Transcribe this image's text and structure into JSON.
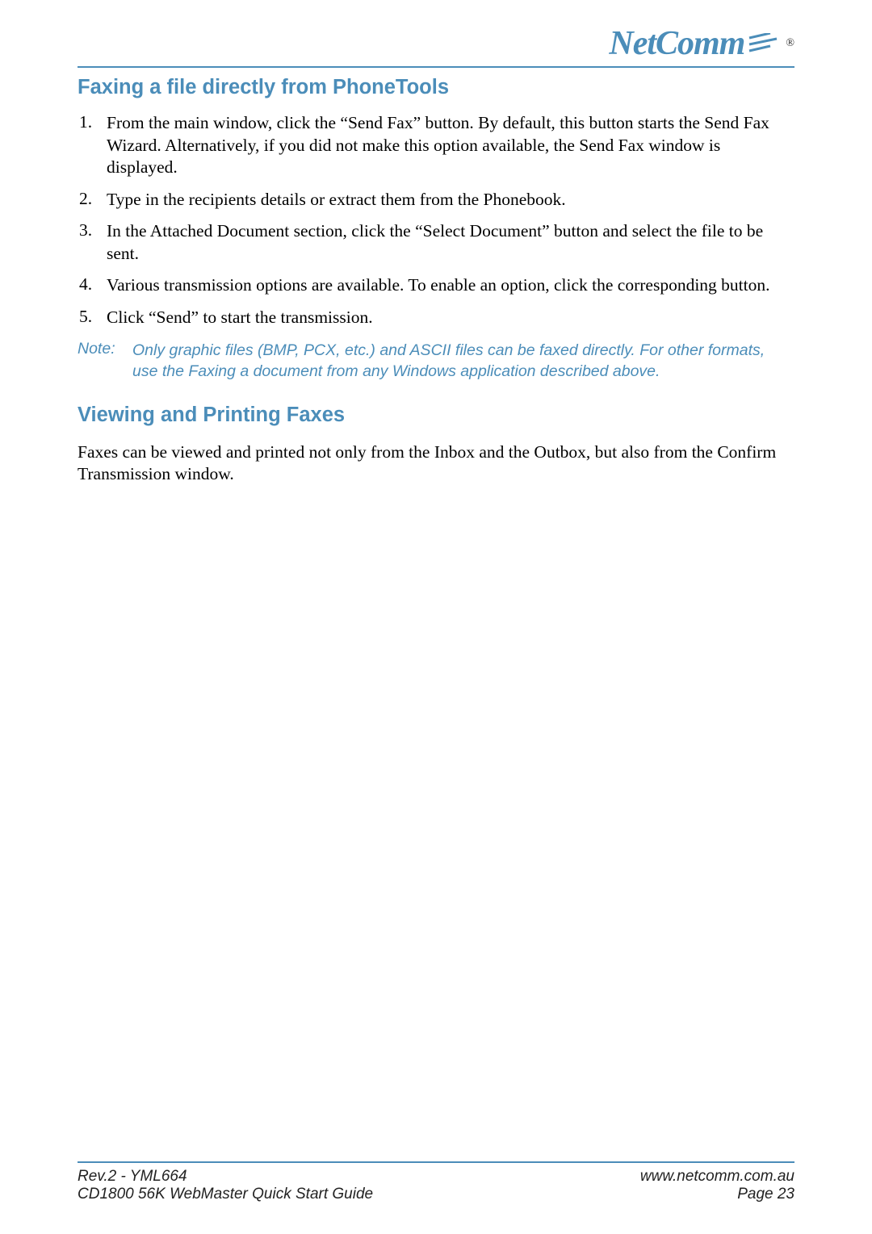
{
  "logo": {
    "brand": "NetComm",
    "registered": "®"
  },
  "heading1": "Faxing a file directly from PhoneTools",
  "steps": [
    {
      "num": "1.",
      "text": "From the main window, click the “Send Fax” button.  By default, this button starts the Send Fax Wizard.  Alternatively, if you did not make this option available, the Send Fax window is displayed."
    },
    {
      "num": "2.",
      "text": "Type in the recipients details or extract them from the Phonebook."
    },
    {
      "num": "3.",
      "text": "In the Attached Document section, click the “Select Document” button and select the file to be sent."
    },
    {
      "num": "4.",
      "text": "Various transmission options are available. To enable an option, click the corresponding button."
    },
    {
      "num": "5.",
      "text": "Click “Send” to start the transmission."
    }
  ],
  "note": {
    "label": "Note:",
    "text": "Only graphic files (BMP, PCX, etc.) and ASCII files can be faxed directly. For other formats, use the Faxing a document from any Windows application described above."
  },
  "heading2": "Viewing and Printing Faxes",
  "para1": "Faxes can be viewed and printed not only from the Inbox and the Outbox, but also from the Confirm Transmission window.",
  "footer": {
    "left1": "Rev.2 - YML664",
    "left2": "CD1800 56K WebMaster Quick Start Guide",
    "right1": "www.netcomm.com.au",
    "right2": "Page 23"
  }
}
